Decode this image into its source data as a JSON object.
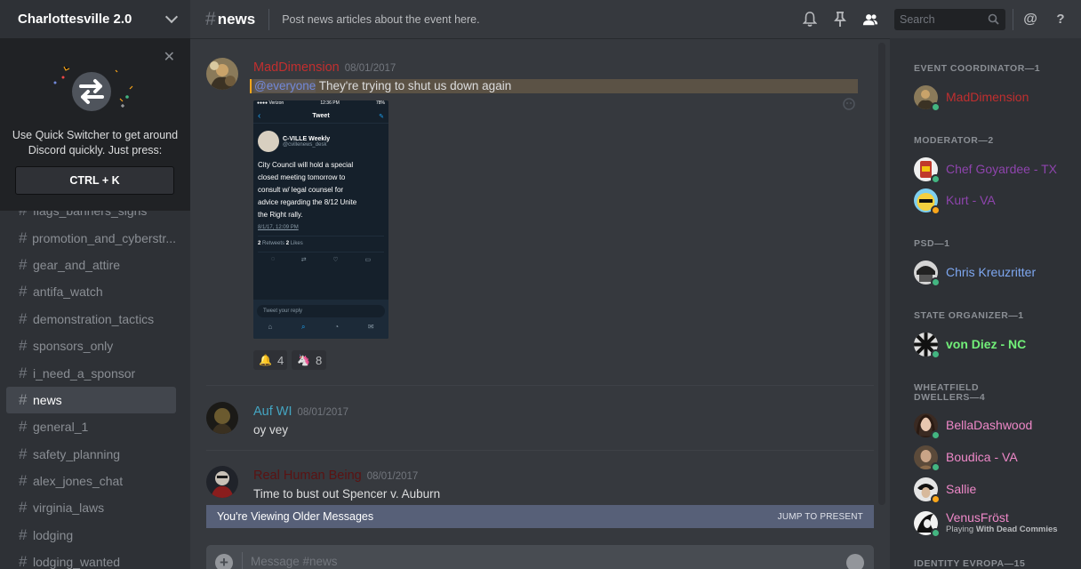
{
  "guild": {
    "name": "Charlottesville 2.0"
  },
  "quick_switcher": {
    "description_line1": "Use Quick Switcher to get around",
    "description_line2": "Discord quickly. Just press:",
    "shortcut": "CTRL + K"
  },
  "channels": [
    "flags_banners_signs",
    "promotion_and_cyberstr...",
    "gear_and_attire",
    "antifa_watch",
    "demonstration_tactics",
    "sponsors_only",
    "i_need_a_sponsor",
    "news",
    "general_1",
    "safety_planning",
    "alex_jones_chat",
    "virginia_laws",
    "lodging",
    "lodging_wanted"
  ],
  "active_channel": "news",
  "header": {
    "channel_name": "news",
    "topic": "Post news articles about the event here.",
    "search_placeholder": "Search"
  },
  "messages": [
    {
      "author": "MadDimension",
      "author_color": "#c12f2f",
      "timestamp": "08/01/2017",
      "mention": "@everyone",
      "text": " They're trying to shut us down again",
      "embed": {
        "carrier": "●●●● Verizon",
        "time": "12:36 PM",
        "battery": "78%",
        "screen_title": "Tweet",
        "account_name": "C-VILLE Weekly",
        "account_handle": "@cvillenews_desk",
        "tweet_text": [
          "City Council will hold a special",
          "closed meeting tomorrow to",
          "consult w/ legal counsel for",
          "advice regarding the 8/12 Unite",
          "the Right rally."
        ],
        "tweet_time": "8/1/17, 12:09 PM",
        "retweets": "2",
        "retweets_label": "Retweets",
        "likes": "2",
        "likes_label": "Likes",
        "reply_placeholder": "Tweet your reply"
      },
      "reactions": [
        {
          "emoji": "bell",
          "count": "4"
        },
        {
          "emoji": "unicorn",
          "count": "8"
        }
      ]
    },
    {
      "author": "Auf WI",
      "author_color": "#44a5c2",
      "timestamp": "08/01/2017",
      "text": "oy vey"
    },
    {
      "author": "Real Human Being",
      "author_color": "#5a1212",
      "timestamp": "08/01/2017",
      "text": "Time to bust out Spencer v. Auburn"
    }
  ],
  "older_messages_bar": {
    "label": "You're Viewing Older Messages",
    "action": "JUMP TO PRESENT"
  },
  "composer": {
    "placeholder": "Message #news"
  },
  "member_groups": [
    {
      "title": "EVENT COORDINATOR—1",
      "members": [
        {
          "name": "MadDimension",
          "color": "#c12f2f",
          "status": "online"
        }
      ]
    },
    {
      "title": "MODERATOR—2",
      "members": [
        {
          "name": "Chef Goyardee - TX",
          "color": "#8e44ad",
          "status": "online"
        },
        {
          "name": "Kurt - VA",
          "color": "#8e44ad",
          "status": "idle"
        }
      ]
    },
    {
      "title": "PSD—1",
      "members": [
        {
          "name": "Chris Kreuzritter",
          "color": "#7ea7f0",
          "status": "online"
        }
      ]
    },
    {
      "title": "STATE ORGANIZER—1",
      "members": [
        {
          "name": "von Diez - NC",
          "color": "#72f079",
          "status": "online"
        }
      ]
    },
    {
      "title": "WHEATFIELD DWELLERS—4",
      "members": [
        {
          "name": "BellaDashwood",
          "color": "#ee88c8",
          "status": "online"
        },
        {
          "name": "Boudica - VA",
          "color": "#ee88c8",
          "status": "online"
        },
        {
          "name": "Sallie",
          "color": "#ee88c8",
          "status": "idle"
        },
        {
          "name": "VenusFröst",
          "color": "#ee88c8",
          "status": "online",
          "activity_prefix": "Playing",
          "activity": "With Dead Commies"
        }
      ]
    },
    {
      "title": "IDENTITY EVROPA—15",
      "members": []
    }
  ],
  "colors": {
    "online": "#43b581",
    "idle": "#faa61a",
    "mention_bg": "#5b5245",
    "mention_bar": "#faa61a",
    "older_bar": "#576078"
  }
}
